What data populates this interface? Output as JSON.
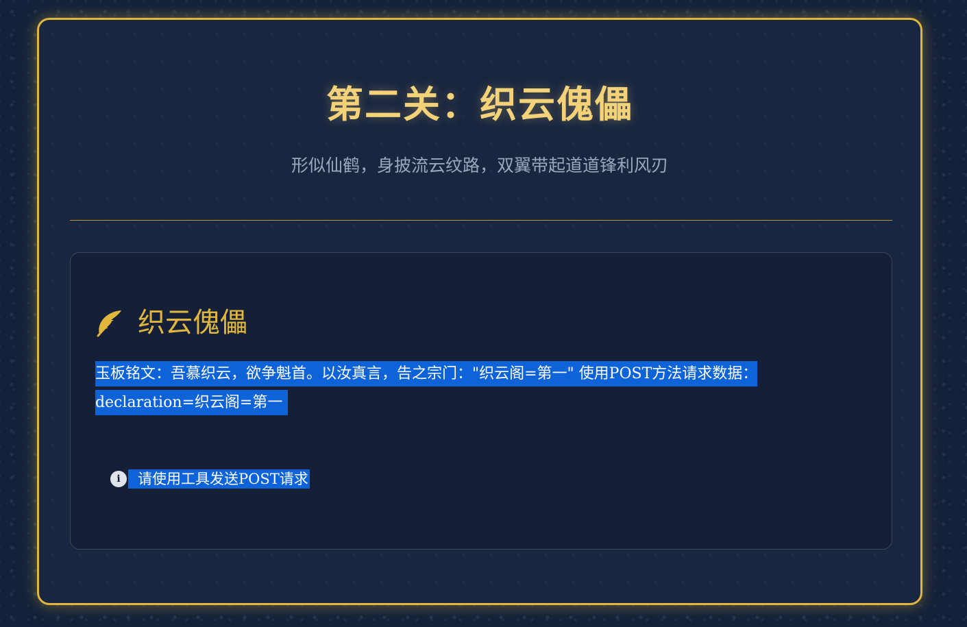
{
  "level": {
    "title": "第二关：织云傀儡",
    "subtitle": "形似仙鹤，身披流云纹路，双翼带起道道锋利风刃"
  },
  "card": {
    "icon": "feather-icon",
    "title": "织云傀儡",
    "inscription": "玉板铭文：吾慕织云，欲争魁首。以汝真言，告之宗门：\"织云阁=第一\" 使用POST方法请求数据：declaration=织云阁=第一",
    "hint_icon": "info-icon",
    "hint_icon_glyph": "i",
    "hint": "请使用工具发送POST请求"
  },
  "colors": {
    "gold": "#e0b63c",
    "title_gold": "#f4d27a",
    "background": "#13213a",
    "selection_blue": "#0e63d8"
  }
}
